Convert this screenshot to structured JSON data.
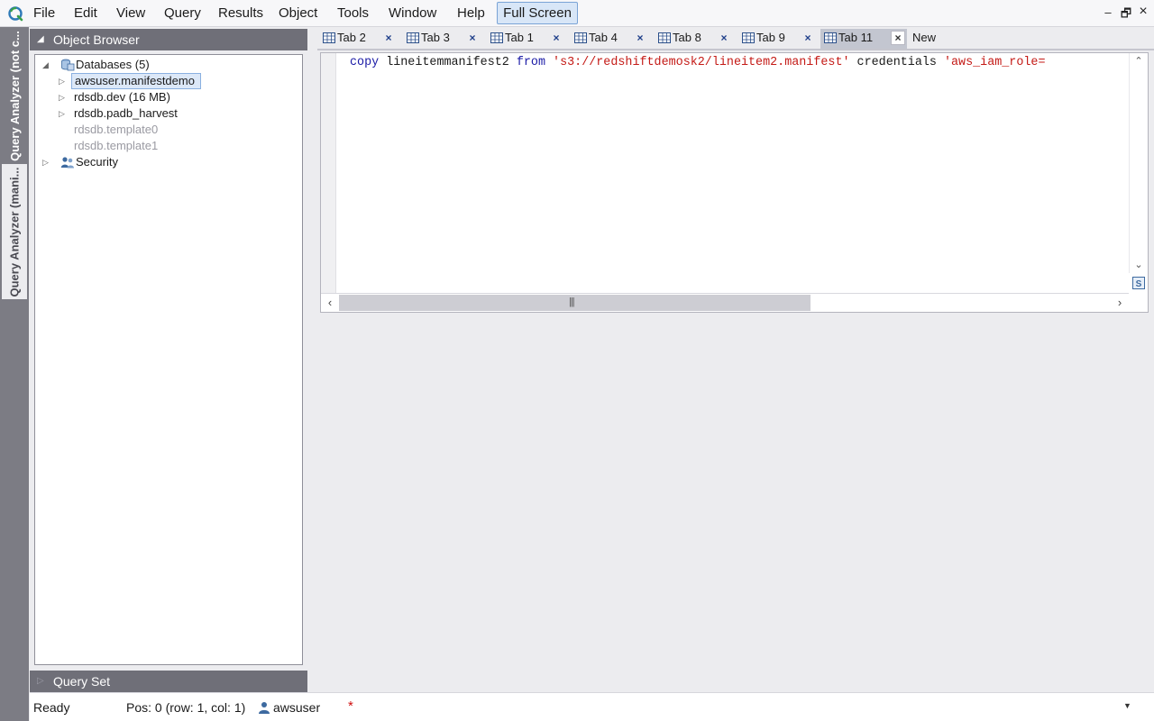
{
  "menu": {
    "items": [
      "File",
      "Edit",
      "View",
      "Query",
      "Results",
      "Object",
      "Tools",
      "Window",
      "Help"
    ],
    "fullscreen_label": "Full Screen"
  },
  "window_controls": {
    "minimize": "–",
    "restore": "🗗",
    "close": "×"
  },
  "vertical_tabs": [
    "Query Analyzer (not c...",
    "Query Analyzer (mani..."
  ],
  "object_browser": {
    "title": "Object Browser",
    "tree": {
      "databases_label": "Databases (5)",
      "databases": [
        {
          "name": "awsuser.manifestdemo",
          "selected": true,
          "expandable": true
        },
        {
          "name": "rdsdb.dev (16 MB)",
          "selected": false,
          "expandable": true
        },
        {
          "name": "rdsdb.padb_harvest",
          "selected": false,
          "expandable": true
        },
        {
          "name": "rdsdb.template0",
          "selected": false,
          "expandable": false
        },
        {
          "name": "rdsdb.template1",
          "selected": false,
          "expandable": false
        }
      ],
      "security_label": "Security"
    }
  },
  "query_set": {
    "title": "Query Set"
  },
  "tabs": [
    {
      "label": "Tab 2",
      "active": false
    },
    {
      "label": "Tab 3",
      "active": false
    },
    {
      "label": "Tab 1",
      "active": false
    },
    {
      "label": "Tab 4",
      "active": false
    },
    {
      "label": "Tab 8",
      "active": false
    },
    {
      "label": "Tab 9",
      "active": false
    },
    {
      "label": "Tab 11",
      "active": true
    }
  ],
  "new_tab_label": "New",
  "tab_close_glyph": "×",
  "editor": {
    "tokens": [
      {
        "text": "copy",
        "kind": "kw"
      },
      {
        "text": " lineitemmanifest2 ",
        "kind": "plain"
      },
      {
        "text": "from",
        "kind": "kw"
      },
      {
        "text": " ",
        "kind": "plain"
      },
      {
        "text": "'s3://redshiftdemosk2/lineitem2.manifest'",
        "kind": "str"
      },
      {
        "text": " credentials ",
        "kind": "plain"
      },
      {
        "text": "'aws_iam_role=",
        "kind": "str"
      }
    ]
  },
  "status": {
    "ready": "Ready",
    "position": "Pos: 0 (row: 1, col: 1)",
    "user": "awsuser",
    "dirty_marker": "*"
  },
  "colors": {
    "keyword": "#1a1aa6",
    "string": "#c41a16",
    "panel_header": "#6f6f78",
    "selection": "#dce8f8"
  },
  "icons": {
    "app": "app-logo-icon",
    "databases": "database-icon",
    "security": "users-icon",
    "tab": "grid-icon",
    "user": "user-icon"
  }
}
